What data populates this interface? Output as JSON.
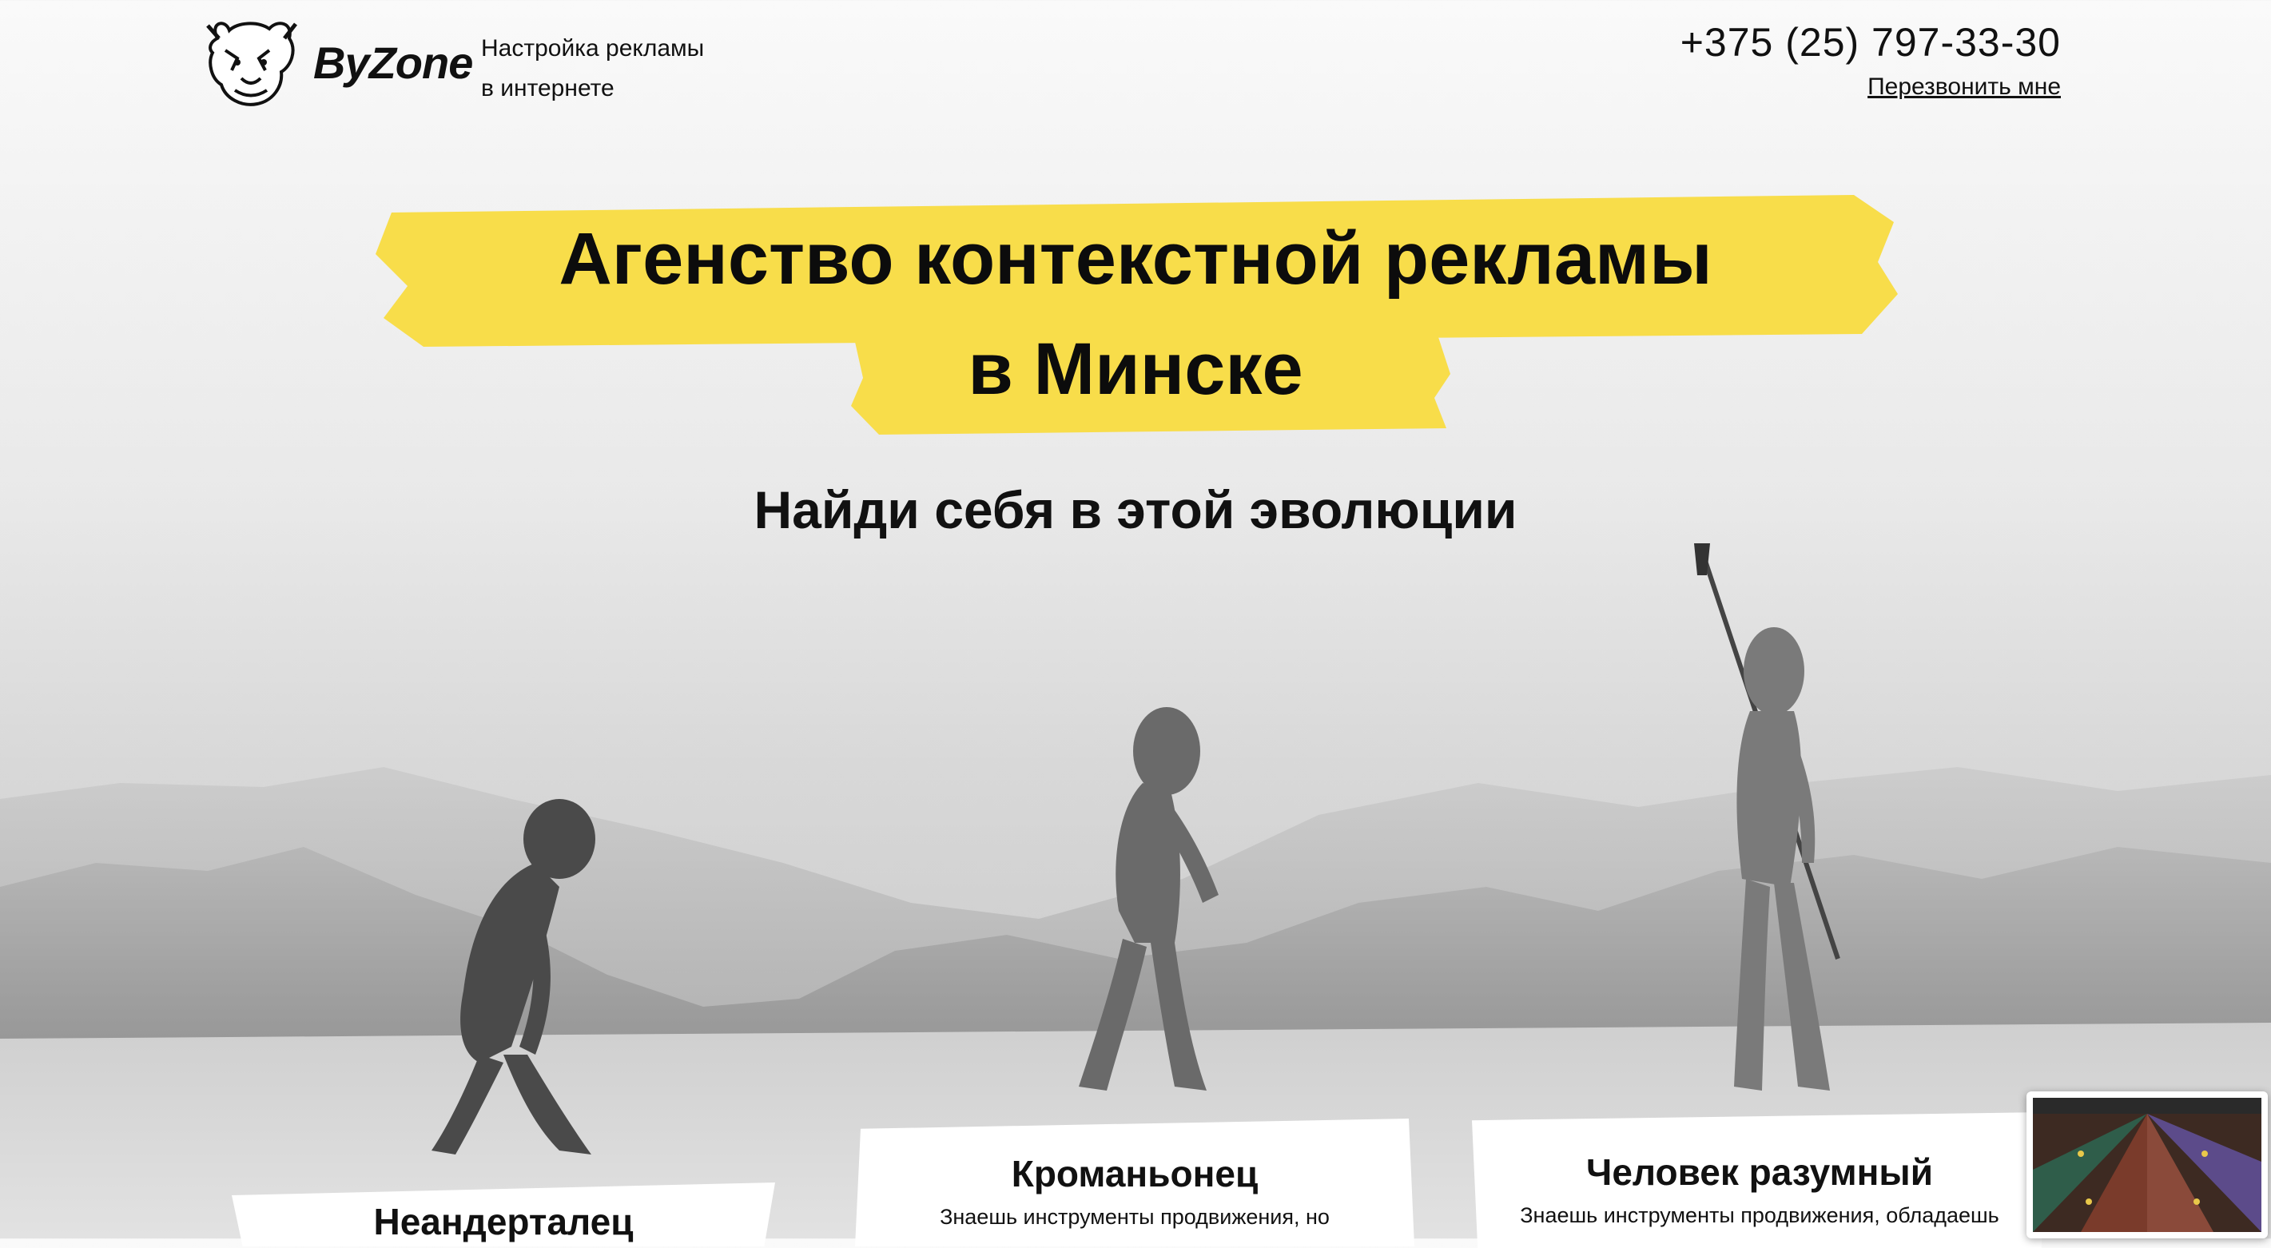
{
  "header": {
    "logo_text": "ByZone",
    "tagline_line1": "Настройка рекламы",
    "tagline_line2": "в интернете",
    "phone": "+375 (25) 797-33-30",
    "callback_label": "Перезвонить мне"
  },
  "hero": {
    "headline_line1": "Агенство контекстной рекламы",
    "headline_line2": "в Минске",
    "subtitle": "Найди себя в этой эволюции",
    "accent_color": "#f8dd4a"
  },
  "cards": [
    {
      "title": "Неандерталец",
      "text": ""
    },
    {
      "title": "Кроманьонец",
      "text": "Знаешь инструменты продвижения, но"
    },
    {
      "title": "Человек разумный",
      "text": "Знаешь инструменты продвижения, обладаешь"
    }
  ],
  "icons": {
    "logo": "bison-head-icon"
  }
}
